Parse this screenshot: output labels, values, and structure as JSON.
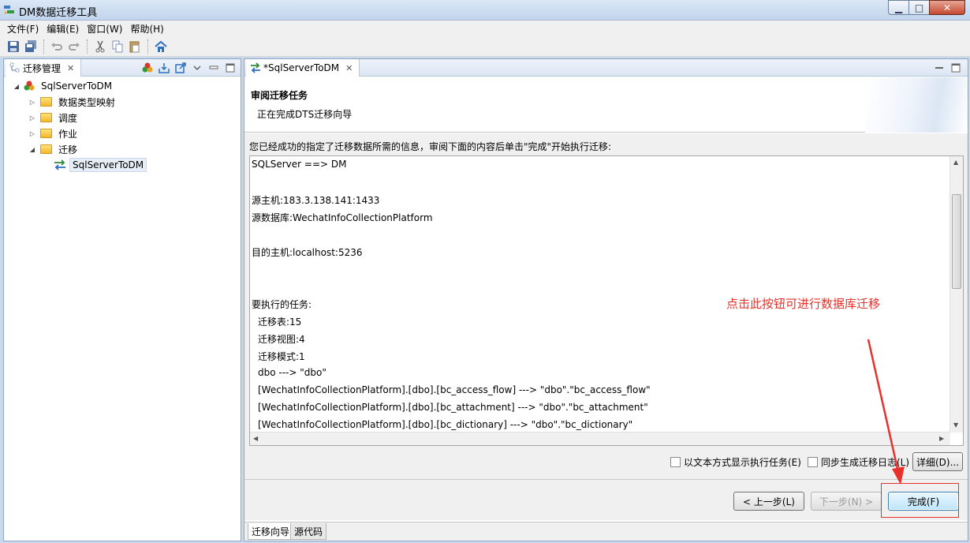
{
  "window": {
    "title": "DM数据迁移工具",
    "min_glyph": "▁",
    "max_glyph": "□",
    "close_glyph": "✕"
  },
  "menu": [
    "文件(F)",
    "编辑(E)",
    "窗口(W)",
    "帮助(H)"
  ],
  "left_panel": {
    "tab_label": "迁移管理",
    "close_glyph": "✕",
    "tree": [
      {
        "label": "SqlServerToDM",
        "level": 0,
        "expanded": true,
        "icon": "project-icon"
      },
      {
        "label": "数据类型映射",
        "level": 1,
        "expanded": false,
        "icon": "folder-icon"
      },
      {
        "label": "调度",
        "level": 1,
        "expanded": false,
        "icon": "folder-icon"
      },
      {
        "label": "作业",
        "level": 1,
        "expanded": false,
        "icon": "folder-icon"
      },
      {
        "label": "迁移",
        "level": 1,
        "expanded": true,
        "icon": "folder-icon"
      },
      {
        "label": "SqlServerToDM",
        "level": 2,
        "selected": true,
        "icon": "migration-icon"
      }
    ]
  },
  "editor": {
    "tab_label": "*SqlServerToDM",
    "close_glyph": "✕",
    "wizard_title": "审阅迁移任务",
    "wizard_subtitle": "正在完成DTS迁移向导",
    "intro": "您已经成功的指定了迁移数据所需的信息，审阅下面的内容后单击\"完成\"开始执行迁移:",
    "summary_lines": [
      "SQLServer ==> DM",
      "",
      "源主机:183.3.138.141:1433",
      "源数据库:WechatInfoCollectionPlatform",
      "",
      "目的主机:localhost:5236",
      "",
      "",
      "要执行的任务:",
      "  迁移表:15",
      "  迁移视图:4",
      "  迁移模式:1",
      "  dbo ---> \"dbo\"",
      "  [WechatInfoCollectionPlatform].[dbo].[bc_access_flow] ---> \"dbo\".\"bc_access_flow\"",
      "  [WechatInfoCollectionPlatform].[dbo].[bc_attachment] ---> \"dbo\".\"bc_attachment\"",
      "  [WechatInfoCollectionPlatform].[dbo].[bc_dictionary] ---> \"dbo\".\"bc_dictionary\""
    ],
    "annotation": "点击此按钮可进行数据库迁移",
    "annotation_color": "#e8312a",
    "option_text_mode": "以文本方式显示执行任务(E)",
    "option_sync_log": "同步生成迁移日志(L)",
    "details_button": "详细(D)...",
    "back_button": "< 上一步(L)",
    "next_button": "下一步(N) >",
    "finish_button": "完成(F)",
    "bottom_tabs": [
      "迁移向导",
      "源代码"
    ]
  }
}
